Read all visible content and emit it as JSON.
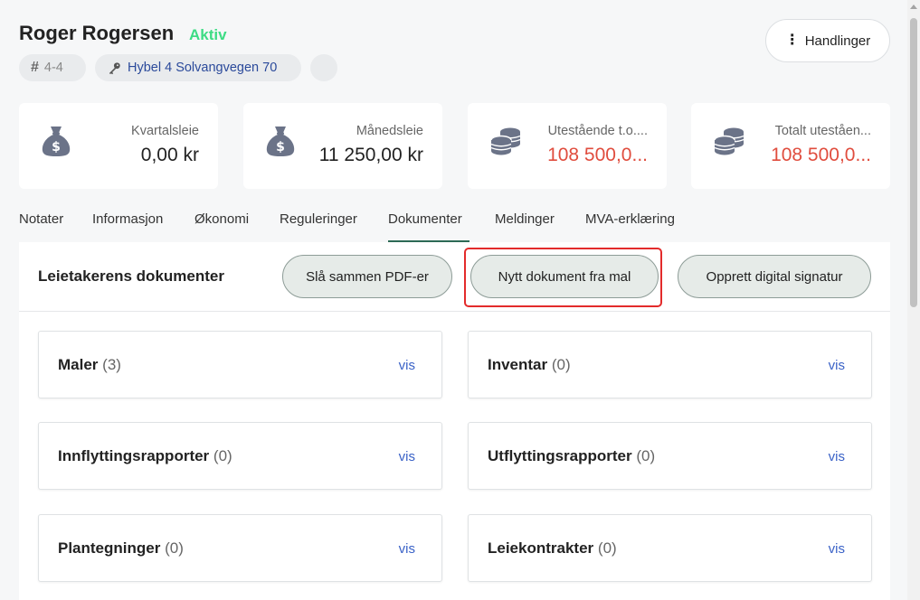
{
  "tenant": {
    "name": "Roger Rogersen",
    "status": "Aktiv",
    "id_label": "4-4",
    "address": "Hybel 4 Solvangvegen 70"
  },
  "header": {
    "actions_label": "Handlinger"
  },
  "stats": [
    {
      "label": "Kvartalsleie",
      "value": "0,00 kr",
      "icon": "money-bag-icon"
    },
    {
      "label": "Månedsleie",
      "value": "11 250,00 kr",
      "icon": "money-bag-icon"
    },
    {
      "label": "Utestående t.o....",
      "value": "108 500,0...",
      "icon": "coins-stack-icon"
    },
    {
      "label": "Totalt uteståen...",
      "value": "108 500,0...",
      "icon": "coins-stack-icon"
    }
  ],
  "tabs": [
    "Notater",
    "Informasjon",
    "Økonomi",
    "Reguleringer",
    "Dokumenter",
    "Meldinger",
    "MVA-erklæring"
  ],
  "active_tab": "Dokumenter",
  "documents": {
    "title": "Leietakerens dokumenter",
    "merge_button": "Slå sammen PDF-er",
    "new_from_template_button": "Nytt dokument fra mal",
    "digital_signature_button": "Opprett digital signatur",
    "categories": [
      {
        "name": "Maler",
        "count": "(3)",
        "link": "vis"
      },
      {
        "name": "Inventar",
        "count": "(0)",
        "link": "vis"
      },
      {
        "name": "Innflyttingsrapporter",
        "count": "(0)",
        "link": "vis"
      },
      {
        "name": "Utflyttingsrapporter",
        "count": "(0)",
        "link": "vis"
      },
      {
        "name": "Plantegninger",
        "count": "(0)",
        "link": "vis"
      },
      {
        "name": "Leiekontrakter",
        "count": "(0)",
        "link": "vis"
      }
    ]
  },
  "colors": {
    "status_green": "#3ddc84",
    "outstanding_red": "#e04d3e",
    "link_blue": "#3a62c7",
    "highlight_red": "#e32b2b",
    "active_tab_underline": "#2d6a55",
    "icon_gray": "#6b7388"
  }
}
